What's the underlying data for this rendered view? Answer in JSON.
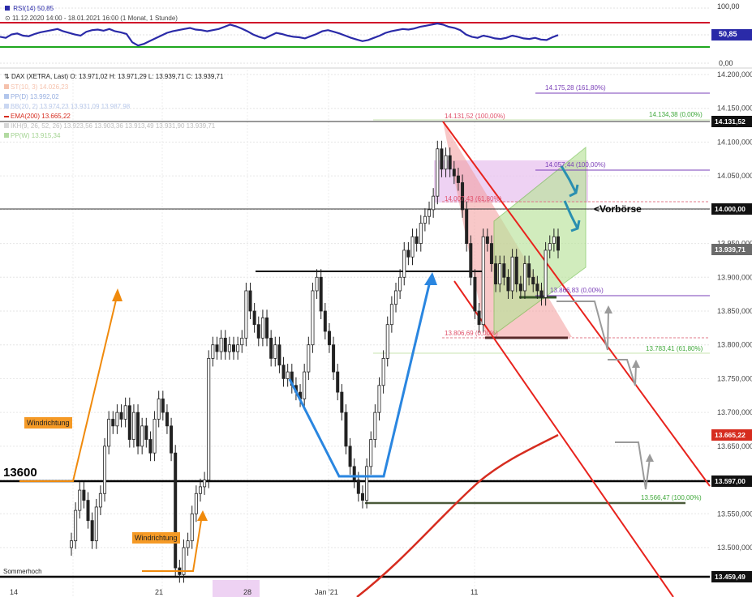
{
  "rsi_panel": {
    "legend_label": "RSI(14)",
    "legend_value": "50,85",
    "timerange": "11.12.2020 14:00 - 18.01.2021 16:00",
    "timeframe": "(1 Monat, 1 Stunde)",
    "axis_labels": [
      "100,00",
      "50,00",
      "0,00"
    ],
    "current_value_badge": "50,85"
  },
  "main_panel": {
    "ohlc_header": "DAX (XETRA, Last)  O: 13.971,02  H: 13.971,29  L: 13.939,71  C: 13.939,71",
    "legend": [
      {
        "label": "ST(10, 3)",
        "values": "14.026,23",
        "color": "#f2a88a"
      },
      {
        "label": "PP(D)",
        "values": "13.992,02",
        "color": "#9fb8e8"
      },
      {
        "label": "BB(20, 2)",
        "values": "13.974,23   13.931,09   13.987,98",
        "color": "#9fb8e8"
      },
      {
        "label": "EMA(200)",
        "values": "13.665,22",
        "color": "#d62c1f"
      },
      {
        "label": "IKH(9, 26, 52, 26)",
        "values": "13.923,56   13.903,36   13.913,49   13.931,90   13.939,71",
        "color": "#bdbdbd"
      },
      {
        "label": "PP(W)",
        "values": "13.915,34",
        "color": "#9fd28a"
      }
    ],
    "annotations": {
      "windrichtung_1": "Windrichtung",
      "windrichtung_2": "Windrichtung",
      "level_13600": "13600",
      "sommerhoch": "Sommerhoch",
      "vorboerse": "<Vorbörse"
    },
    "fib_labels": {
      "f161": "14.175,28 (161,80%)",
      "f14134": "14.134,38 (0,00%)",
      "f14131": "14.131,52 (100,00%)",
      "f14057": "14.057,44 (100,00%)",
      "f14007": "14.007,43 (61,80%)",
      "f13866": "13.866,83 (0,00%)",
      "f13806": "13.806,69 (0,00%)",
      "f13783": "13.783,41 (61,80%)",
      "f13566": "13.566,47 (100,00%)"
    },
    "price_badges": {
      "b14131": "14.131,52",
      "b14000": "14.000,00",
      "b13939": "13.939,71",
      "b13665": "13.665,22",
      "b13597": "13.597,00",
      "b13459": "13.459,49"
    },
    "x_tick_labels": [
      "14",
      "21",
      "28",
      "Jan '21",
      "11"
    ]
  },
  "colors": {
    "rsi_line": "#2a2aa8",
    "rsi_upper": "#d0122a",
    "rsi_lower": "#1ea81e",
    "ema": "#d62c1f",
    "channel": "#e8231d",
    "arrow_orange": "#f08a0c",
    "arrow_blue": "#2a86e0",
    "arrow_teal": "#2a8fb0",
    "triangle_red": "#f29a9a",
    "parallelogram_green": "#b9e39a",
    "pink_zone": "#e8c3ef"
  },
  "chart_data": {
    "type": "candlestick",
    "title": "DAX (XETRA, Last)",
    "timeframe": "1 Stunde",
    "x_ticks": [
      "14",
      "21",
      "28",
      "Jan '21",
      "11"
    ],
    "y_ticks": [
      14200,
      14150,
      14100,
      14050,
      14000,
      13950,
      13900,
      13850,
      13800,
      13750,
      13700,
      13650,
      13600,
      13550,
      13500
    ],
    "ylim": [
      13450,
      14220
    ],
    "ohlc_last": {
      "open": 13971.02,
      "high": 13971.29,
      "low": 13939.71,
      "close": 13939.71
    },
    "closes": [
      13510,
      13555,
      13585,
      13570,
      13540,
      13510,
      13560,
      13580,
      13650,
      13690,
      13680,
      13700,
      13690,
      13710,
      13660,
      13700,
      13650,
      13680,
      13660,
      13640,
      13690,
      13720,
      13700,
      13680,
      13640,
      13470,
      13460,
      13500,
      13510,
      13550,
      13580,
      13590,
      13600,
      13780,
      13800,
      13790,
      13810,
      13790,
      13800,
      13790,
      13800,
      13810,
      13880,
      13850,
      13830,
      13810,
      13840,
      13810,
      13780,
      13800,
      13770,
      13750,
      13760,
      13740,
      13730,
      13720,
      13760,
      13800,
      13880,
      13900,
      13850,
      13820,
      13800,
      13760,
      13730,
      13700,
      13650,
      13620,
      13600,
      13580,
      13570,
      13620,
      13660,
      13700,
      13740,
      13780,
      13830,
      13860,
      13880,
      13900,
      13940,
      13930,
      13960,
      13950,
      13980,
      13990,
      14000,
      14020,
      14090,
      14060,
      14080,
      14060,
      14050,
      14040,
      14000,
      13950,
      13900,
      13850,
      13830,
      13960,
      13950,
      13920,
      13890,
      13920,
      13900,
      13880,
      13930,
      13890,
      13880,
      13920,
      13900,
      13890,
      13880,
      13870,
      13940,
      13950,
      13960,
      13940
    ],
    "rsi": [
      48,
      46,
      52,
      54,
      50,
      49,
      53,
      56,
      58,
      60,
      62,
      58,
      55,
      52,
      50,
      57,
      60,
      61,
      59,
      62,
      58,
      56,
      53,
      38,
      32,
      35,
      40,
      45,
      50,
      55,
      58,
      60,
      62,
      64,
      61,
      60,
      58,
      60,
      62,
      66,
      70,
      67,
      63,
      58,
      52,
      48,
      45,
      50,
      55,
      53,
      50,
      48,
      47,
      45,
      49,
      53,
      58,
      60,
      57,
      54,
      50,
      46,
      43,
      40,
      42,
      46,
      50,
      55,
      58,
      60,
      62,
      61,
      63,
      66,
      68,
      70,
      72,
      70,
      66,
      64,
      60,
      52,
      48,
      46,
      50,
      48,
      45,
      44,
      46,
      50,
      48,
      45,
      44,
      46,
      43,
      42,
      47,
      51
    ],
    "rsi_levels": [
      70,
      30
    ],
    "rsi_ylim": [
      0,
      100
    ],
    "ema200": [
      13460,
      13490,
      13520,
      13550,
      13580,
      13605,
      13620,
      13635,
      13648,
      13658,
      13665
    ],
    "horizontal_levels": [
      14175.28,
      14134.38,
      14131.52,
      14057.44,
      14007.43,
      14000.0,
      13866.83,
      13806.69,
      13783.41,
      13597.0,
      13566.47,
      13459.49
    ]
  }
}
